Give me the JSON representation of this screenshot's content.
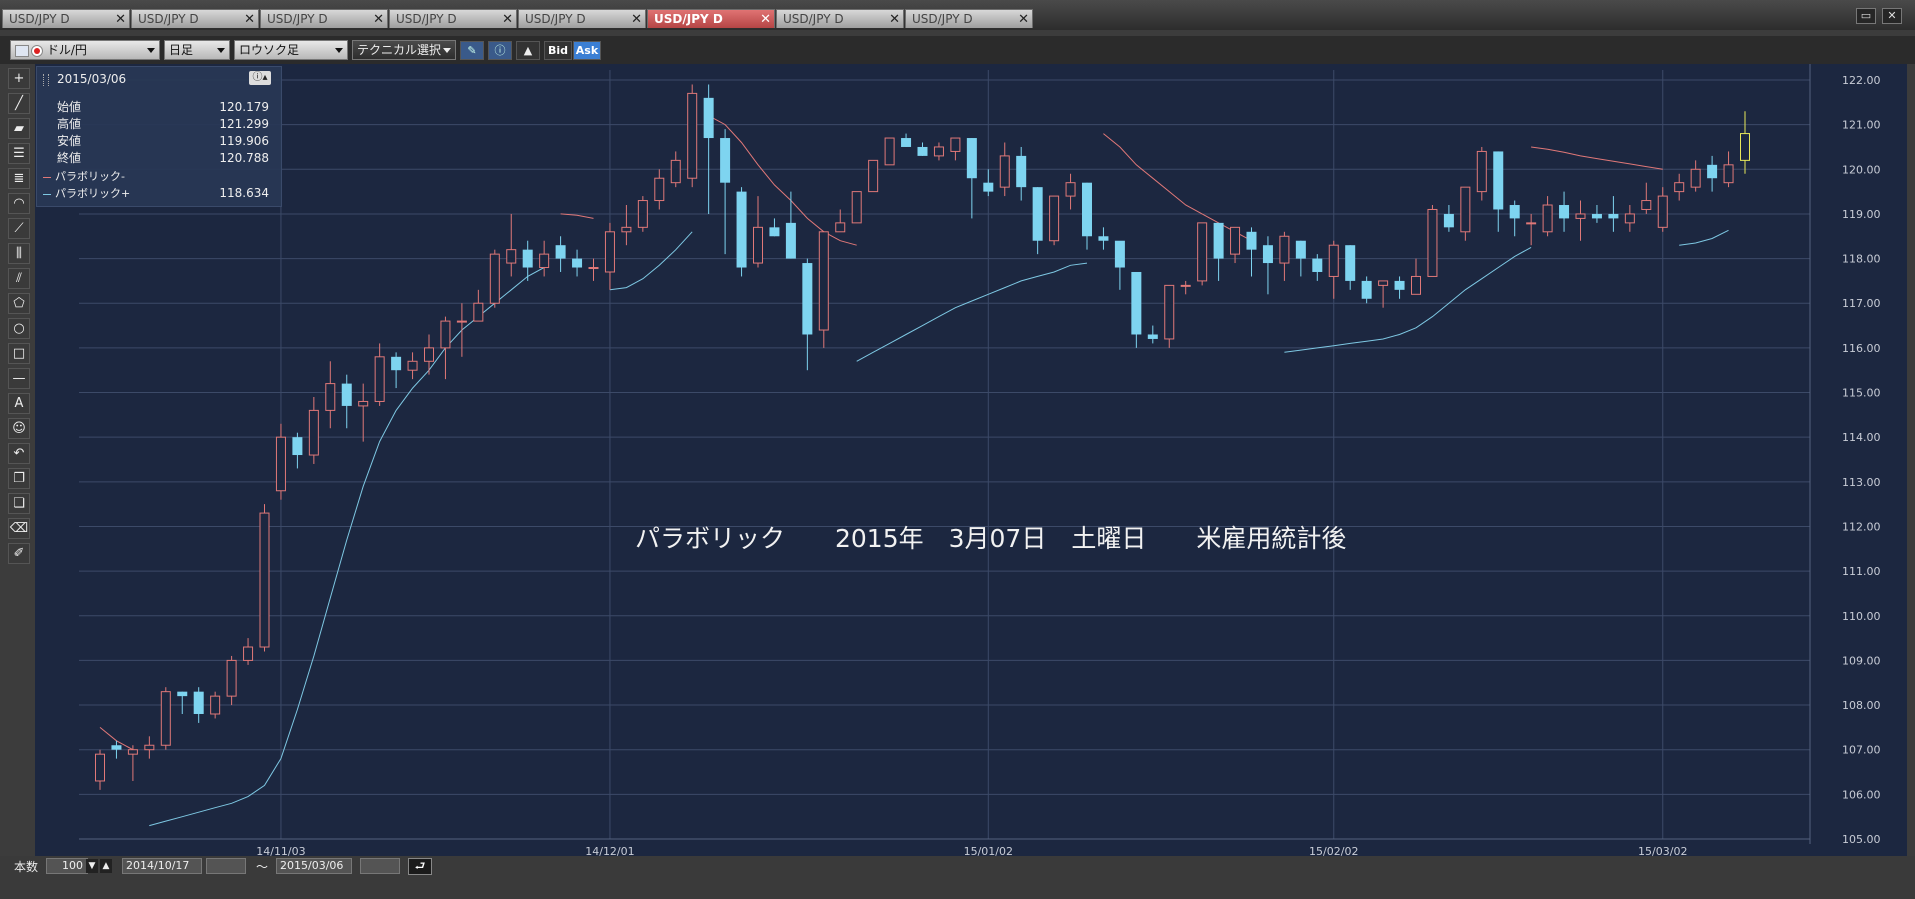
{
  "tabs": [
    {
      "label": "USD/JPY D",
      "active": false
    },
    {
      "label": "USD/JPY D",
      "active": false
    },
    {
      "label": "USD/JPY D",
      "active": false
    },
    {
      "label": "USD/JPY D",
      "active": false
    },
    {
      "label": "USD/JPY D",
      "active": false
    },
    {
      "label": "USD/JPY D",
      "active": true
    },
    {
      "label": "USD/JPY D",
      "active": false
    },
    {
      "label": "USD/JPY D",
      "active": false
    }
  ],
  "toolbar": {
    "pair": "ドル/円",
    "period": "日足",
    "chart_type": "ロウソク足",
    "technical": "テクニカル選択",
    "bid": "Bid",
    "ask": "Ask"
  },
  "info": {
    "date": "2015/03/06",
    "rows": [
      {
        "label": "始値",
        "value": "120.179"
      },
      {
        "label": "高値",
        "value": "121.299"
      },
      {
        "label": "安値",
        "value": "119.906"
      },
      {
        "label": "終値",
        "value": "120.788"
      }
    ],
    "indicators": [
      {
        "label": "パラボリック-",
        "value": "",
        "color": "#e07878"
      },
      {
        "label": "パラボリック+",
        "value": "118.634",
        "color": "#7ec8e3"
      }
    ]
  },
  "bottom": {
    "count_label": "本数",
    "count_value": "100",
    "from_date": "2014/10/17",
    "tilde": "〜",
    "to_date": "2015/03/06"
  },
  "colors": {
    "up": "#e07878",
    "down": "#7ed4f0",
    "sar_minus": "#e07878",
    "sar_plus": "#7ec8e3",
    "last": "#e8e85a",
    "bg": "#1c2740",
    "grid": "#3c4a68"
  },
  "chart_data": {
    "type": "candlestick",
    "title": "",
    "annotation": "パラボリック　　2015年　3月07日　土曜日　　米雇用統計後",
    "ylim": [
      105.0,
      122.0
    ],
    "y_ticks": [
      "105.00",
      "106.00",
      "107.00",
      "108.00",
      "109.00",
      "110.00",
      "111.00",
      "112.00",
      "113.00",
      "114.00",
      "115.00",
      "116.00",
      "117.00",
      "118.00",
      "119.00",
      "120.00",
      "121.00",
      "122.00"
    ],
    "x_labels": [
      {
        "label": "14/11/03",
        "index": 11
      },
      {
        "label": "14/12/01",
        "index": 31
      },
      {
        "label": "15/01/02",
        "index": 54
      },
      {
        "label": "15/02/02",
        "index": 75
      },
      {
        "label": "15/03/02",
        "index": 95
      }
    ],
    "candles": [
      [
        106.3,
        106.9,
        106.1,
        107.0
      ],
      [
        107.1,
        107.0,
        106.8,
        107.2
      ],
      [
        106.9,
        107.0,
        106.3,
        107.1
      ],
      [
        107.0,
        107.1,
        106.8,
        107.3
      ],
      [
        107.1,
        108.3,
        107.0,
        108.4
      ],
      [
        108.3,
        108.2,
        107.8,
        108.3
      ],
      [
        108.3,
        107.8,
        107.6,
        108.4
      ],
      [
        107.8,
        108.2,
        107.7,
        108.3
      ],
      [
        108.2,
        109.0,
        108.0,
        109.1
      ],
      [
        109.0,
        109.3,
        108.9,
        109.5
      ],
      [
        109.3,
        112.3,
        109.2,
        112.5
      ],
      [
        112.8,
        114.0,
        112.6,
        114.3
      ],
      [
        114.0,
        113.6,
        113.3,
        114.1
      ],
      [
        113.6,
        114.6,
        113.4,
        114.9
      ],
      [
        114.6,
        115.2,
        114.2,
        115.7
      ],
      [
        115.2,
        114.7,
        114.2,
        115.4
      ],
      [
        114.7,
        114.8,
        113.9,
        115.2
      ],
      [
        114.8,
        115.8,
        114.7,
        116.1
      ],
      [
        115.8,
        115.5,
        115.1,
        115.9
      ],
      [
        115.5,
        115.7,
        115.3,
        115.9
      ],
      [
        115.7,
        116.0,
        115.4,
        116.3
      ],
      [
        116.0,
        116.6,
        115.3,
        116.7
      ],
      [
        116.6,
        116.6,
        115.8,
        117.0
      ],
      [
        116.6,
        117.0,
        116.6,
        117.3
      ],
      [
        117.0,
        118.1,
        116.9,
        118.2
      ],
      [
        117.9,
        118.2,
        117.6,
        119.0
      ],
      [
        118.2,
        117.8,
        117.5,
        118.4
      ],
      [
        117.8,
        118.1,
        117.6,
        118.4
      ],
      [
        118.3,
        118.0,
        117.7,
        118.5
      ],
      [
        118.0,
        117.8,
        117.6,
        118.2
      ],
      [
        117.8,
        117.8,
        117.5,
        118.0
      ],
      [
        117.7,
        118.6,
        117.3,
        118.8
      ],
      [
        118.6,
        118.7,
        118.3,
        119.2
      ],
      [
        118.7,
        119.3,
        118.6,
        119.4
      ],
      [
        119.3,
        119.8,
        119.1,
        120.0
      ],
      [
        119.7,
        120.2,
        119.6,
        120.4
      ],
      [
        119.8,
        121.7,
        119.6,
        121.9
      ],
      [
        121.6,
        120.7,
        119.0,
        121.9
      ],
      [
        120.7,
        119.7,
        118.1,
        120.9
      ],
      [
        119.5,
        117.8,
        117.6,
        119.6
      ],
      [
        117.9,
        118.7,
        117.8,
        119.4
      ],
      [
        118.7,
        118.5,
        118.5,
        118.9
      ],
      [
        118.8,
        118.0,
        118.0,
        119.5
      ],
      [
        117.9,
        116.3,
        115.5,
        118.0
      ],
      [
        116.4,
        118.6,
        116.0,
        118.6
      ],
      [
        118.6,
        118.8,
        118.6,
        119.1
      ],
      [
        118.8,
        119.5,
        118.8,
        119.5
      ],
      [
        119.5,
        120.2,
        119.5,
        120.2
      ],
      [
        120.1,
        120.7,
        120.1,
        120.7
      ],
      [
        120.7,
        120.5,
        120.5,
        120.8
      ],
      [
        120.5,
        120.3,
        120.3,
        120.6
      ],
      [
        120.3,
        120.5,
        120.2,
        120.6
      ],
      [
        120.4,
        120.7,
        120.2,
        120.7
      ],
      [
        120.7,
        119.8,
        118.9,
        120.7
      ],
      [
        119.7,
        119.5,
        119.4,
        120.0
      ],
      [
        119.6,
        120.3,
        119.4,
        120.6
      ],
      [
        120.3,
        119.6,
        119.3,
        120.5
      ],
      [
        119.6,
        118.4,
        118.1,
        119.6
      ],
      [
        118.4,
        119.4,
        118.3,
        119.4
      ],
      [
        119.4,
        119.7,
        119.1,
        119.9
      ],
      [
        119.7,
        118.5,
        118.2,
        119.7
      ],
      [
        118.5,
        118.4,
        118.2,
        118.7
      ],
      [
        118.4,
        117.8,
        117.3,
        118.2
      ],
      [
        117.7,
        116.3,
        116.0,
        117.5
      ],
      [
        116.3,
        116.2,
        116.1,
        116.5
      ],
      [
        116.2,
        117.4,
        116.0,
        117.4
      ],
      [
        117.4,
        117.4,
        117.2,
        117.5
      ],
      [
        117.5,
        118.8,
        117.4,
        118.8
      ],
      [
        118.8,
        118.0,
        117.5,
        118.8
      ],
      [
        118.1,
        118.7,
        117.9,
        118.7
      ],
      [
        118.6,
        118.2,
        117.6,
        118.7
      ],
      [
        118.3,
        117.9,
        117.2,
        118.5
      ],
      [
        117.9,
        118.5,
        117.5,
        118.6
      ],
      [
        118.4,
        118.0,
        117.6,
        118.4
      ],
      [
        118.0,
        117.7,
        117.5,
        118.1
      ],
      [
        117.6,
        118.3,
        117.1,
        118.4
      ],
      [
        118.3,
        117.5,
        117.3,
        118.3
      ],
      [
        117.5,
        117.1,
        117.0,
        117.6
      ],
      [
        117.4,
        117.5,
        116.9,
        117.5
      ],
      [
        117.5,
        117.3,
        117.1,
        117.6
      ],
      [
        117.2,
        117.6,
        117.2,
        118.0
      ],
      [
        117.6,
        119.1,
        117.6,
        119.2
      ],
      [
        119.0,
        118.7,
        118.6,
        119.2
      ],
      [
        118.6,
        119.6,
        118.4,
        119.6
      ],
      [
        119.5,
        120.4,
        119.3,
        120.5
      ],
      [
        120.4,
        119.1,
        118.6,
        120.4
      ],
      [
        119.2,
        118.9,
        118.5,
        119.3
      ],
      [
        118.8,
        118.8,
        118.3,
        119.0
      ],
      [
        118.6,
        119.2,
        118.5,
        119.4
      ],
      [
        119.2,
        118.9,
        118.6,
        119.5
      ],
      [
        118.9,
        119.0,
        118.4,
        119.3
      ],
      [
        119.0,
        118.9,
        118.8,
        119.2
      ],
      [
        119.0,
        118.9,
        118.6,
        119.4
      ],
      [
        118.8,
        119.0,
        118.6,
        119.2
      ],
      [
        119.1,
        119.3,
        119.0,
        119.7
      ],
      [
        118.7,
        119.4,
        118.6,
        119.6
      ],
      [
        119.5,
        119.7,
        119.3,
        119.9
      ],
      [
        119.6,
        120.0,
        119.5,
        120.2
      ],
      [
        120.1,
        119.8,
        119.5,
        120.3
      ],
      [
        119.7,
        120.1,
        119.6,
        120.4
      ],
      [
        120.2,
        120.8,
        119.9,
        121.3
      ]
    ],
    "sar_minus": [
      [
        [
          0,
          107.5
        ],
        [
          1,
          107.2
        ],
        [
          2,
          107.0
        ]
      ],
      [
        [
          28,
          119.0
        ],
        [
          29,
          118.97
        ],
        [
          30,
          118.9
        ]
      ],
      [
        [
          37,
          121.2
        ],
        [
          38,
          121.0
        ],
        [
          39,
          120.6
        ],
        [
          40,
          120.1
        ],
        [
          41,
          119.65
        ],
        [
          42,
          119.3
        ],
        [
          43,
          118.9
        ],
        [
          44,
          118.6
        ],
        [
          45,
          118.4
        ],
        [
          46,
          118.3
        ]
      ],
      [
        [
          61,
          120.8
        ],
        [
          62,
          120.5
        ],
        [
          63,
          120.1
        ],
        [
          64,
          119.8
        ],
        [
          65,
          119.5
        ],
        [
          66,
          119.2
        ],
        [
          67,
          119.0
        ],
        [
          68,
          118.8
        ],
        [
          69,
          118.6
        ],
        [
          70,
          118.4
        ]
      ],
      [
        [
          87,
          120.5
        ],
        [
          88,
          120.45
        ],
        [
          89,
          120.38
        ],
        [
          90,
          120.3
        ],
        [
          91,
          120.24
        ],
        [
          92,
          120.18
        ],
        [
          93,
          120.12
        ],
        [
          94,
          120.06
        ],
        [
          95,
          120.0
        ]
      ]
    ],
    "sar_plus": [
      [
        [
          3,
          105.3
        ],
        [
          4,
          105.4
        ],
        [
          5,
          105.5
        ],
        [
          6,
          105.6
        ],
        [
          7,
          105.7
        ],
        [
          8,
          105.8
        ],
        [
          9,
          105.95
        ],
        [
          10,
          106.2
        ],
        [
          11,
          106.8
        ],
        [
          12,
          107.9
        ],
        [
          13,
          109.1
        ],
        [
          14,
          110.4
        ],
        [
          15,
          111.7
        ],
        [
          16,
          112.9
        ],
        [
          17,
          113.9
        ],
        [
          18,
          114.6
        ],
        [
          19,
          115.1
        ],
        [
          20,
          115.5
        ],
        [
          21,
          116.0
        ],
        [
          22,
          116.4
        ],
        [
          23,
          116.7
        ],
        [
          24,
          117.0
        ],
        [
          25,
          117.3
        ],
        [
          26,
          117.6
        ],
        [
          27,
          117.8
        ]
      ],
      [
        [
          31,
          117.3
        ],
        [
          32,
          117.35
        ],
        [
          33,
          117.55
        ],
        [
          34,
          117.85
        ],
        [
          35,
          118.2
        ],
        [
          36,
          118.6
        ]
      ],
      [
        [
          46,
          115.7
        ],
        [
          47,
          115.9
        ],
        [
          48,
          116.1
        ],
        [
          49,
          116.3
        ],
        [
          50,
          116.5
        ],
        [
          51,
          116.7
        ],
        [
          52,
          116.9
        ],
        [
          53,
          117.05
        ],
        [
          54,
          117.2
        ],
        [
          55,
          117.35
        ],
        [
          56,
          117.5
        ],
        [
          57,
          117.6
        ],
        [
          58,
          117.7
        ],
        [
          59,
          117.85
        ],
        [
          60,
          117.9
        ]
      ],
      [
        [
          72,
          115.9
        ],
        [
          73,
          115.95
        ],
        [
          74,
          116.0
        ],
        [
          75,
          116.05
        ],
        [
          76,
          116.1
        ],
        [
          77,
          116.15
        ],
        [
          78,
          116.2
        ],
        [
          79,
          116.3
        ],
        [
          80,
          116.45
        ],
        [
          81,
          116.7
        ],
        [
          82,
          117.0
        ],
        [
          83,
          117.3
        ],
        [
          84,
          117.55
        ],
        [
          85,
          117.8
        ],
        [
          86,
          118.05
        ],
        [
          87,
          118.25
        ]
      ],
      [
        [
          96,
          118.3
        ],
        [
          97,
          118.35
        ],
        [
          98,
          118.45
        ],
        [
          99,
          118.634
        ]
      ]
    ]
  }
}
